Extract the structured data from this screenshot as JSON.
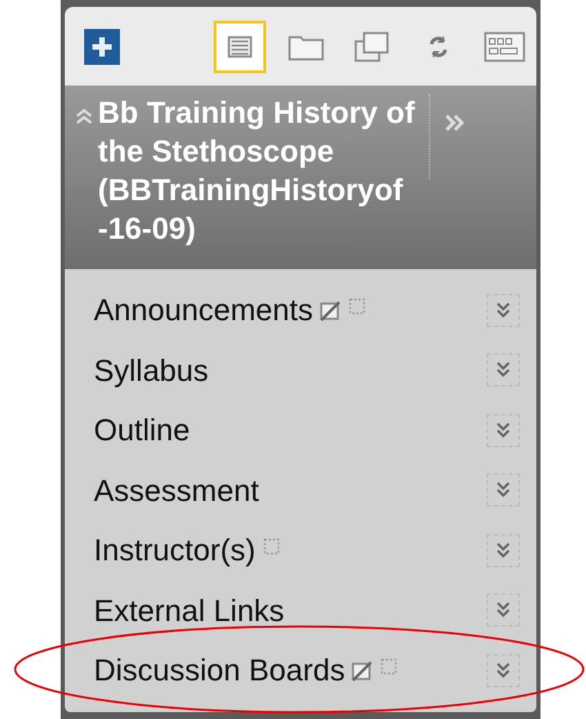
{
  "toolbar": {
    "buttons": [
      {
        "kind": "list",
        "selected": true
      },
      {
        "kind": "folder",
        "selected": false
      },
      {
        "kind": "windows",
        "selected": false
      },
      {
        "kind": "refresh",
        "selected": false
      },
      {
        "kind": "grid",
        "selected": false
      }
    ]
  },
  "course": {
    "title": "Bb Training History of the Stethoscope (BBTrainingHistoryof -16-09)",
    "expanded": true
  },
  "menu_items": [
    {
      "label": "Announcements",
      "hidden": true,
      "empty": true,
      "circled": false
    },
    {
      "label": "Syllabus",
      "hidden": false,
      "empty": false,
      "circled": false
    },
    {
      "label": "Outline",
      "hidden": false,
      "empty": false,
      "circled": false
    },
    {
      "label": "Assessment",
      "hidden": false,
      "empty": false,
      "circled": false
    },
    {
      "label": "Instructor(s)",
      "hidden": false,
      "empty": true,
      "circled": false
    },
    {
      "label": "External Links",
      "hidden": false,
      "empty": false,
      "circled": false
    },
    {
      "label": "Discussion Boards",
      "hidden": true,
      "empty": true,
      "circled": true
    }
  ]
}
